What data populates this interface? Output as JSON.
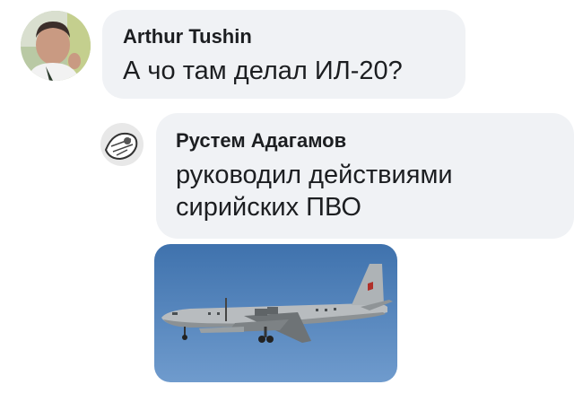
{
  "comments": [
    {
      "author": "Arthur Tushin",
      "text": "А чо там делал ИЛ-20?",
      "avatar_icon": "user-photo-avatar"
    },
    {
      "author": "Рустем Адагамов",
      "text_lines": [
        "руководил действиями",
        "сирийских ПВО"
      ],
      "avatar_icon": "user-sketch-avatar",
      "attachment_icon": "airplane-photo"
    }
  ],
  "colors": {
    "bubble": "#f0f2f5",
    "text": "#1c1e21",
    "sky": "#4f7fb6"
  }
}
